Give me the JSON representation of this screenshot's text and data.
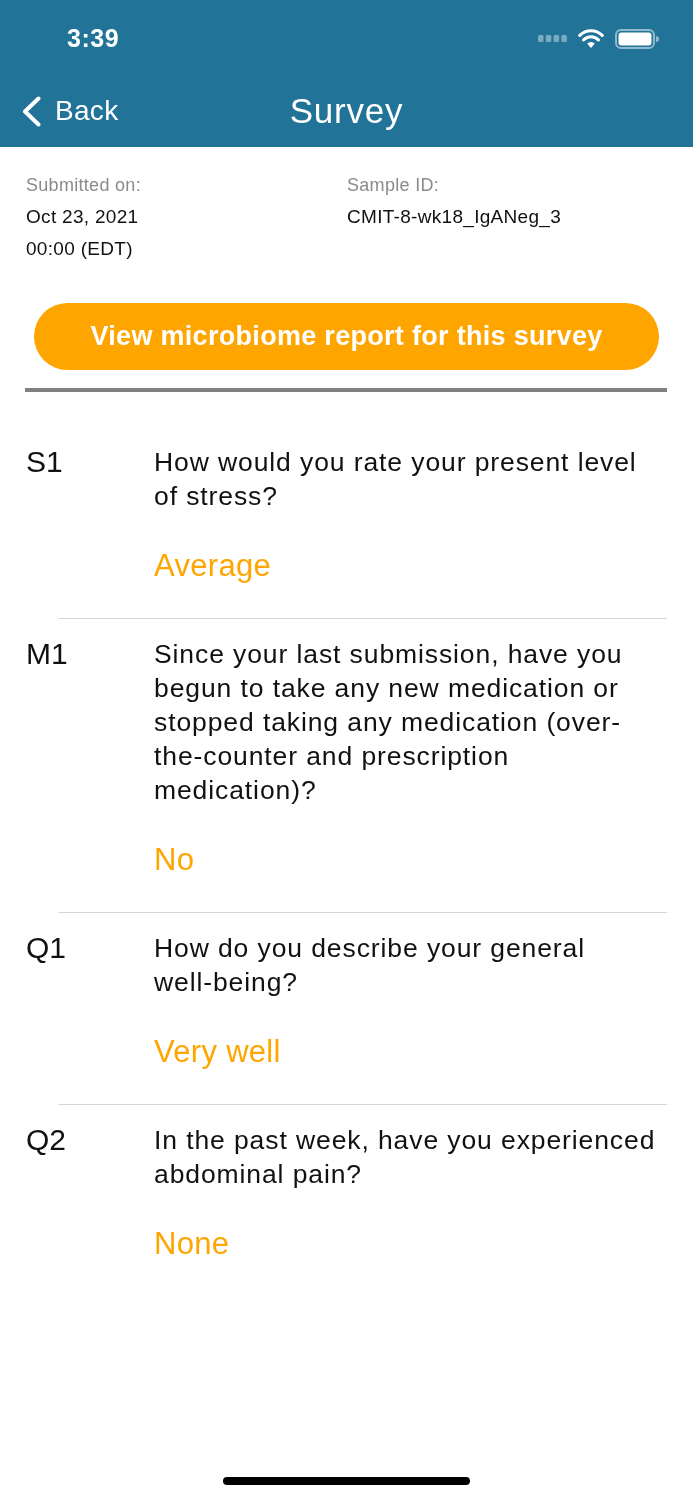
{
  "status_bar": {
    "time": "3:39"
  },
  "nav_bar": {
    "back_label": "Back",
    "title": "Survey"
  },
  "details": [
    {
      "label": "Submitted on:",
      "lines": [
        "Oct 23, 2021",
        "00:00 (EDT)"
      ]
    },
    {
      "label": "Sample ID:",
      "lines": [
        "CMIT-8-wk18_IgANeg_3"
      ]
    }
  ],
  "report_button": {
    "label": "View microbiome report for this survey"
  },
  "questions": [
    {
      "code": "S1",
      "question": "How would you rate your present level of stress?",
      "answer": "Average"
    },
    {
      "code": "M1",
      "question": "Since your last submission, have you begun to take any new medication or stopped taking any medication (over-the-counter and prescription medication)?",
      "answer": "No"
    },
    {
      "code": "Q1",
      "question": "How do you describe your general well-being?",
      "answer": "Very well"
    },
    {
      "code": "Q2",
      "question": "In the past week, have you experienced abdominal pain?",
      "answer": "None"
    }
  ]
}
